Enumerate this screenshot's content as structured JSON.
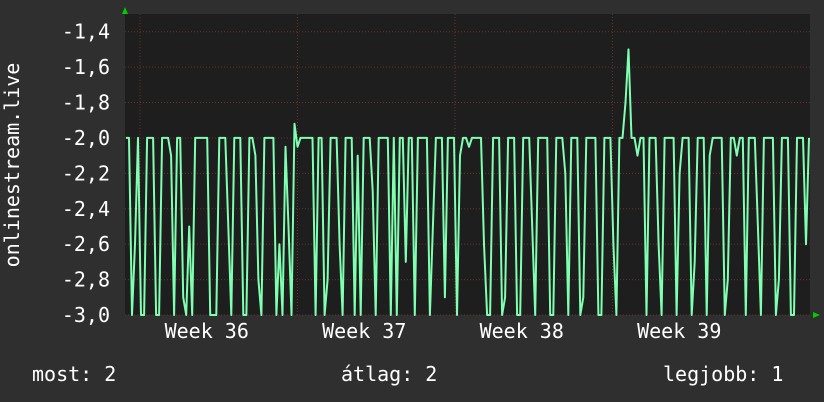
{
  "chart_data": {
    "type": "line",
    "ylabel": "onlinestream.live",
    "ylim": [
      -3.0,
      -1.3
    ],
    "y_ticks": [
      "-1,4",
      "-1,6",
      "-1,8",
      "-2,0",
      "-2,2",
      "-2,4",
      "-2,6",
      "-2,8",
      "-3,0"
    ],
    "y_tick_values": [
      -1.4,
      -1.6,
      -1.8,
      -2.0,
      -2.2,
      -2.4,
      -2.6,
      -2.8,
      -3.0
    ],
    "x_ticks": [
      "Week 36",
      "Week 37",
      "Week 38",
      "Week 39"
    ],
    "grid": true,
    "series": [
      {
        "color": "#7fffb0",
        "values": [
          -2.0,
          -2.0,
          -3.0,
          -2.6,
          -2.0,
          -3.0,
          -3.0,
          -2.0,
          -2.0,
          -2.0,
          -3.0,
          -3.0,
          -2.0,
          -2.0,
          -2.0,
          -2.1,
          -3.0,
          -2.0,
          -2.0,
          -2.9,
          -3.0,
          -2.5,
          -3.0,
          -2.0,
          -2.0,
          -2.0,
          -2.0,
          -2.0,
          -3.0,
          -3.0,
          -3.0,
          -2.0,
          -2.0,
          -2.0,
          -2.5,
          -3.0,
          -2.0,
          -2.0,
          -2.0,
          -3.0,
          -3.0,
          -2.0,
          -2.0,
          -2.1,
          -2.8,
          -3.0,
          -2.0,
          -2.0,
          -2.0,
          -2.0,
          -3.0,
          -2.6,
          -3.0,
          -2.05,
          -2.5,
          -3.0,
          -1.92,
          -2.05,
          -2.0,
          -2.0,
          -2.0,
          -2.0,
          -2.0,
          -3.0,
          -2.0,
          -2.0,
          -3.0,
          -2.8,
          -2.0,
          -2.0,
          -2.0,
          -2.6,
          -3.0,
          -2.0,
          -2.0,
          -2.0,
          -3.0,
          -2.1,
          -3.0,
          -2.0,
          -2.0,
          -2.0,
          -2.3,
          -3.0,
          -2.0,
          -2.0,
          -2.0,
          -2.0,
          -3.0,
          -2.0,
          -3.0,
          -2.0,
          -2.0,
          -2.7,
          -2.0,
          -2.0,
          -3.0,
          -2.0,
          -2.0,
          -2.0,
          -2.0,
          -3.0,
          -2.5,
          -2.0,
          -2.0,
          -2.0,
          -2.9,
          -2.0,
          -2.0,
          -2.0,
          -3.0,
          -2.1,
          -2.0,
          -2.0,
          -2.05,
          -2.0,
          -2.0,
          -2.0,
          -2.0,
          -2.6,
          -3.0,
          -3.0,
          -2.0,
          -2.0,
          -2.0,
          -3.0,
          -2.9,
          -2.0,
          -2.0,
          -2.0,
          -3.0,
          -3.0,
          -2.0,
          -2.0,
          -2.0,
          -2.5,
          -3.0,
          -2.0,
          -2.0,
          -2.0,
          -2.0,
          -3.0,
          -3.0,
          -2.0,
          -2.0,
          -2.0,
          -2.2,
          -3.0,
          -2.0,
          -2.0,
          -2.0,
          -3.0,
          -2.9,
          -2.0,
          -2.0,
          -2.0,
          -2.0,
          -3.0,
          -3.0,
          -2.0,
          -2.0,
          -2.0,
          -2.6,
          -3.0,
          -2.0,
          -2.0,
          -1.8,
          -1.5,
          -2.0,
          -2.0,
          -2.1,
          -2.0,
          -2.0,
          -3.0,
          -2.0,
          -2.0,
          -2.0,
          -2.6,
          -3.0,
          -2.0,
          -2.0,
          -2.0,
          -2.0,
          -3.0,
          -2.2,
          -2.0,
          -2.0,
          -2.0,
          -3.0,
          -2.7,
          -2.0,
          -2.0,
          -2.0,
          -3.0,
          -2.1,
          -2.0,
          -2.0,
          -2.0,
          -2.0,
          -3.0,
          -2.8,
          -2.0,
          -2.0,
          -2.1,
          -2.0,
          -2.0,
          -3.0,
          -2.0,
          -2.0,
          -2.0,
          -2.5,
          -3.0,
          -2.0,
          -2.0,
          -2.0,
          -2.0,
          -3.0,
          -2.8,
          -2.0,
          -2.0,
          -2.0,
          -3.0,
          -3.0,
          -2.0,
          -2.0,
          -2.0,
          -2.6,
          -2.0
        ]
      }
    ]
  },
  "footer": {
    "now": "most: 2",
    "avg": "átlag: 2",
    "best": "legjobb: 1"
  },
  "colors": {
    "background": "#2f2f2f",
    "plot_background": "#1e1e1e",
    "grid": "#6a3030",
    "line": "#7fffb0",
    "text": "#ffffff",
    "axis_arrow": "#00cc00"
  }
}
